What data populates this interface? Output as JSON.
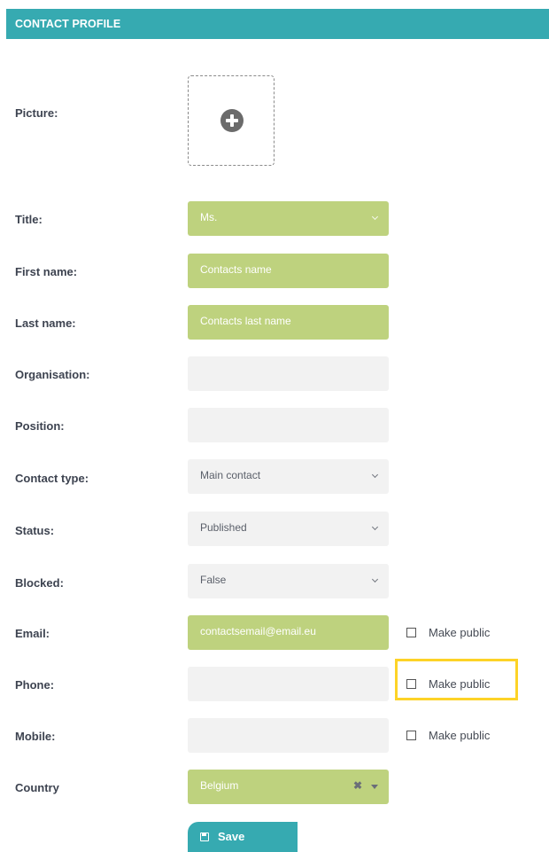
{
  "header": {
    "title": "CONTACT PROFILE"
  },
  "labels": {
    "picture": "Picture:",
    "title": "Title:",
    "first_name": "First name:",
    "last_name": "Last name:",
    "organisation": "Organisation:",
    "position": "Position:",
    "contact_type": "Contact type:",
    "status": "Status:",
    "blocked": "Blocked:",
    "email": "Email:",
    "phone": "Phone:",
    "mobile": "Mobile:",
    "country": "Country"
  },
  "fields": {
    "title": "Ms.",
    "first_name": "Contacts name",
    "last_name": "Contacts last name",
    "organisation": "",
    "position": "",
    "contact_type": "Main contact",
    "status": "Published",
    "blocked": "False",
    "email": "contactsemail@email.eu",
    "phone": "",
    "mobile": "",
    "country": "Belgium"
  },
  "make_public": {
    "email": "Make public",
    "phone": "Make public",
    "mobile": "Make public"
  },
  "icons": {
    "add_picture": "plus-circle-icon",
    "dropdown": "chevron-down-icon",
    "clear": "close-icon",
    "save": "floppy-disk-icon"
  },
  "colors": {
    "header": "#36aab1",
    "filled_field": "#bed27e",
    "empty_field": "#f2f2f2",
    "highlight": "#fdd327"
  },
  "save_button": {
    "label": "Save"
  }
}
